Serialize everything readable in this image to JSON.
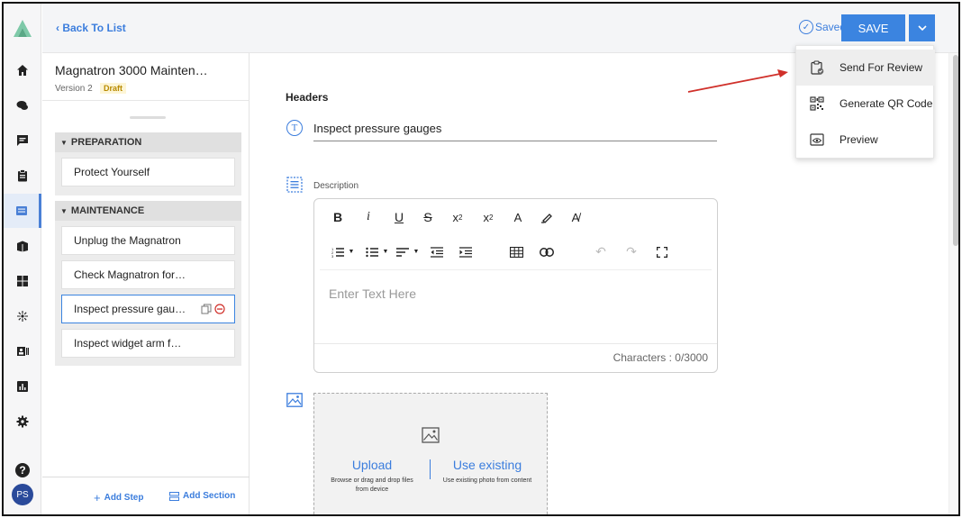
{
  "header": {
    "back_label": "Back To List",
    "saved_label": "Saved",
    "save_label": "SAVE"
  },
  "menu": {
    "items": [
      {
        "label": "Send For Review",
        "icon": "clipboard-check-icon"
      },
      {
        "label": "Generate QR Code",
        "icon": "qr-code-icon"
      },
      {
        "label": "Preview",
        "icon": "preview-icon"
      }
    ]
  },
  "procedure": {
    "title": "Magnatron 3000 Mainten…",
    "version": "Version 2",
    "status": "Draft"
  },
  "sections": [
    {
      "name": "PREPARATION",
      "steps": [
        "Protect Yourself"
      ]
    },
    {
      "name": "MAINTENANCE",
      "steps": [
        "Unplug the Magnatron",
        "Check Magnatron for…",
        "Inspect pressure gau…",
        "Inspect widget arm f…"
      ]
    }
  ],
  "footer": {
    "add_step": "Add Step",
    "add_section": "Add Section"
  },
  "editor": {
    "headers_label": "Headers",
    "title_value": "Inspect pressure gauges",
    "description_label": "Description",
    "placeholder": "Enter Text Here",
    "char_count": "Characters : 0/3000"
  },
  "upload": {
    "upload_label": "Upload",
    "upload_hint": "Browse or drag and drop files from device",
    "existing_label": "Use existing",
    "existing_hint": "Use existing photo from content"
  },
  "avatar": {
    "initials": "PS"
  },
  "colors": {
    "accent": "#3b84e0",
    "draft": "#b88a00",
    "arrow": "#d0302a"
  }
}
